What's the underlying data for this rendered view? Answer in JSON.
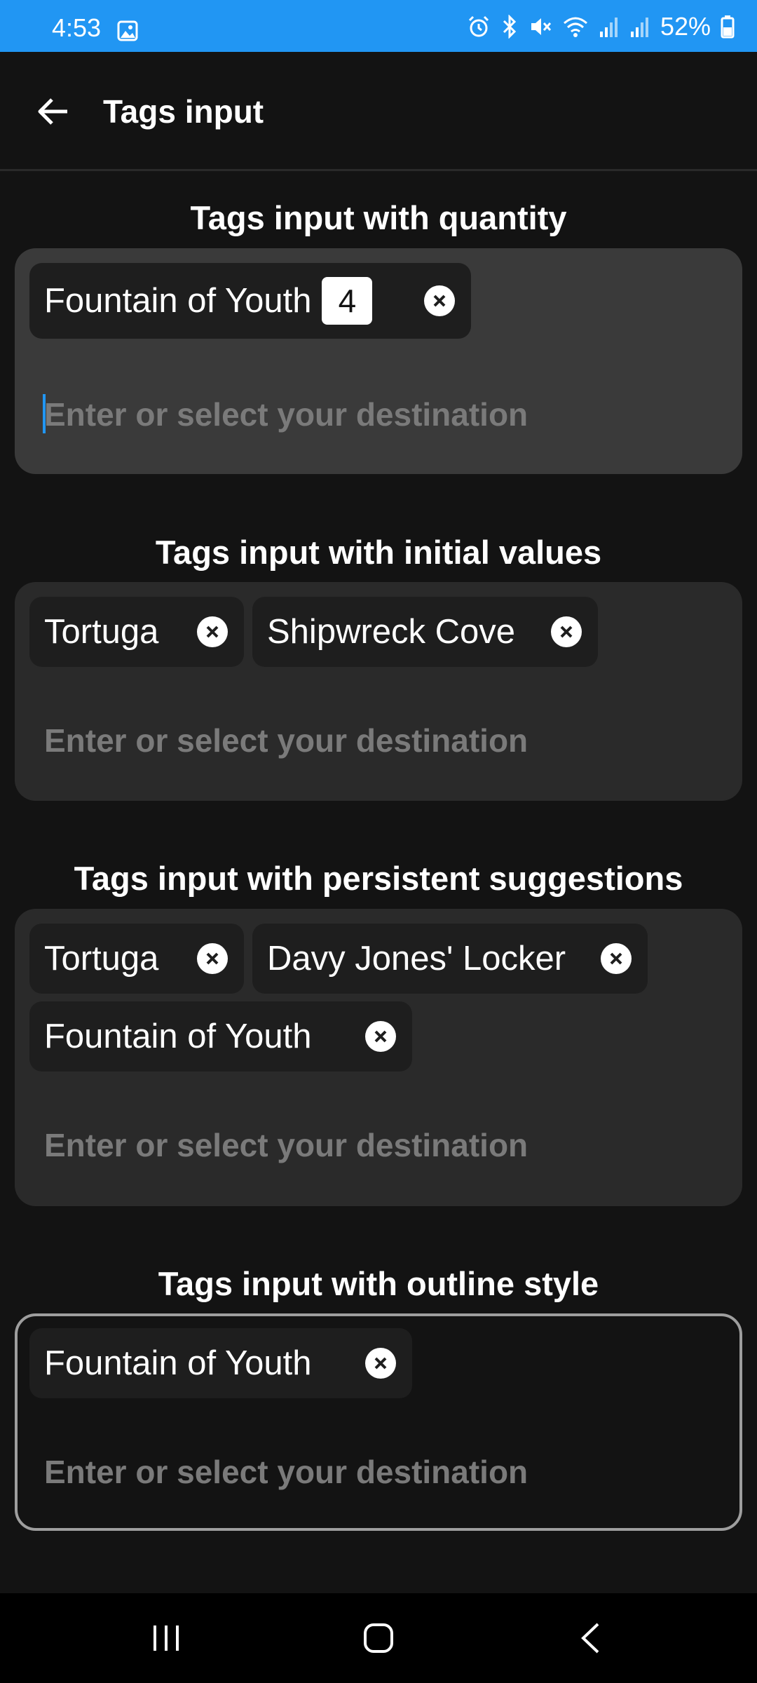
{
  "status_bar": {
    "time": "4:53",
    "battery": "52%",
    "icons": [
      "image-icon",
      "alarm-icon",
      "bluetooth-icon",
      "mute-icon",
      "wifi-icon",
      "signal-icon",
      "signal-icon",
      "battery-icon"
    ],
    "background": "#2196f3"
  },
  "app_bar": {
    "title": "Tags input"
  },
  "sections": [
    {
      "title": "Tags input with quantity",
      "style": "focused",
      "tags": [
        {
          "label": "Fountain of Youth",
          "quantity": "4"
        }
      ],
      "placeholder": "Enter or select your destination"
    },
    {
      "title": "Tags input with initial values",
      "style": "filled",
      "tags": [
        {
          "label": "Tortuga"
        },
        {
          "label": "Shipwreck Cove"
        }
      ],
      "placeholder": "Enter or select your destination"
    },
    {
      "title": "Tags input with persistent suggestions",
      "style": "filled",
      "tags": [
        {
          "label": "Tortuga"
        },
        {
          "label": "Davy Jones' Locker"
        },
        {
          "label": "Fountain of Youth"
        }
      ],
      "placeholder": "Enter or select your destination"
    },
    {
      "title": "Tags input with outline style",
      "style": "outline",
      "tags": [
        {
          "label": "Fountain of Youth"
        }
      ],
      "placeholder": "Enter or select your destination"
    }
  ],
  "colors": {
    "accent": "#2196f3",
    "background": "#131313",
    "field_filled": "#2a2a2a",
    "field_focused": "#3a3a3a",
    "chip": "#1e1e1e",
    "placeholder": "#7a7a7a",
    "outline": "#9e9e9e"
  }
}
